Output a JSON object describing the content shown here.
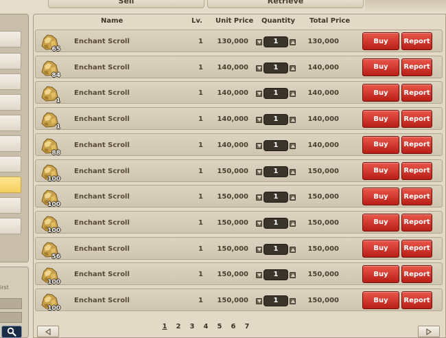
{
  "tabs": {
    "sell": "Sell",
    "retrieve": "Retrieve"
  },
  "left_panel": {
    "first_label": "irst"
  },
  "columns": {
    "name": "Name",
    "lv": "Lv.",
    "unit_price": "Unit Price",
    "quantity": "Quantity",
    "total_price": "Total Price"
  },
  "buttons": {
    "buy": "Buy",
    "report": "Report"
  },
  "rows": [
    {
      "icon": "gold-ore-icon",
      "stack": "65",
      "name": "Enchant Scroll",
      "lv": "1",
      "unit_price": "130,000",
      "quantity": "1",
      "total_price": "130,000"
    },
    {
      "icon": "gold-ore-icon",
      "stack": "84",
      "name": "Enchant Scroll",
      "lv": "1",
      "unit_price": "140,000",
      "quantity": "1",
      "total_price": "140,000"
    },
    {
      "icon": "gold-ore-icon",
      "stack": "1",
      "name": "Enchant Scroll",
      "lv": "1",
      "unit_price": "140,000",
      "quantity": "1",
      "total_price": "140,000"
    },
    {
      "icon": "gold-ore-icon",
      "stack": "1",
      "name": "Enchant Scroll",
      "lv": "1",
      "unit_price": "140,000",
      "quantity": "1",
      "total_price": "140,000"
    },
    {
      "icon": "gold-ore-icon",
      "stack": "88",
      "name": "Enchant Scroll",
      "lv": "1",
      "unit_price": "140,000",
      "quantity": "1",
      "total_price": "140,000"
    },
    {
      "icon": "gold-ore-icon",
      "stack": "100",
      "name": "Enchant Scroll",
      "lv": "1",
      "unit_price": "150,000",
      "quantity": "1",
      "total_price": "150,000"
    },
    {
      "icon": "gold-ore-icon",
      "stack": "100",
      "name": "Enchant Scroll",
      "lv": "1",
      "unit_price": "150,000",
      "quantity": "1",
      "total_price": "150,000"
    },
    {
      "icon": "gold-ore-icon",
      "stack": "100",
      "name": "Enchant Scroll",
      "lv": "1",
      "unit_price": "150,000",
      "quantity": "1",
      "total_price": "150,000"
    },
    {
      "icon": "gold-ore-icon",
      "stack": "56",
      "name": "Enchant Scroll",
      "lv": "1",
      "unit_price": "150,000",
      "quantity": "1",
      "total_price": "150,000"
    },
    {
      "icon": "gold-ore-icon",
      "stack": "100",
      "name": "Enchant Scroll",
      "lv": "1",
      "unit_price": "150,000",
      "quantity": "1",
      "total_price": "150,000"
    },
    {
      "icon": "gold-ore-icon",
      "stack": "100",
      "name": "Enchant Scroll",
      "lv": "1",
      "unit_price": "150,000",
      "quantity": "1",
      "total_price": "150,000"
    }
  ],
  "pagination": {
    "pages": [
      "1",
      "2",
      "3",
      "4",
      "5",
      "6",
      "7"
    ],
    "current": "1"
  },
  "colors": {
    "buy_button": "#c8281e",
    "selected_slot": "#f5cf5c",
    "panel": "#e3d9c7"
  }
}
